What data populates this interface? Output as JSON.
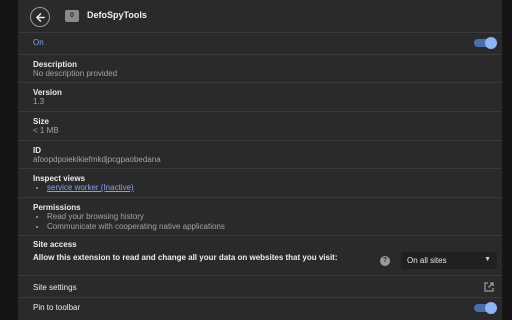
{
  "header": {
    "extension_name": "DefoSpyTools",
    "app_icon_text": "0",
    "back_icon": "arrow-left-icon"
  },
  "enabled": {
    "label": "On",
    "state": true
  },
  "details": {
    "description": {
      "label": "Description",
      "value": "No description provided"
    },
    "version": {
      "label": "Version",
      "value": "1.3"
    },
    "size": {
      "label": "Size",
      "value": "< 1 MB"
    },
    "id": {
      "label": "ID",
      "value": "afoopdpoiekikiefmkdjpcgpaobedana"
    },
    "inspect_views": {
      "label": "Inspect views",
      "items": [
        "service worker (Inactive)"
      ]
    },
    "permissions": {
      "label": "Permissions",
      "items": [
        "Read your browsing history",
        "Communicate with cooperating native applications"
      ]
    }
  },
  "site_access": {
    "title": "Site access",
    "description": "Allow this extension to read and change all your data on websites that you visit:",
    "help_icon": "help-icon",
    "selected": "On all sites"
  },
  "site_settings": {
    "label": "Site settings",
    "icon": "launch-icon"
  },
  "pin_toolbar": {
    "label": "Pin to toolbar",
    "state": true
  },
  "colors": {
    "background": "#2a2a2c",
    "accent_text": "#7fa7ea",
    "toggle_track": "#4b6eab",
    "toggle_knob": "#8fb4f6",
    "separator": "#3a3a3d"
  }
}
